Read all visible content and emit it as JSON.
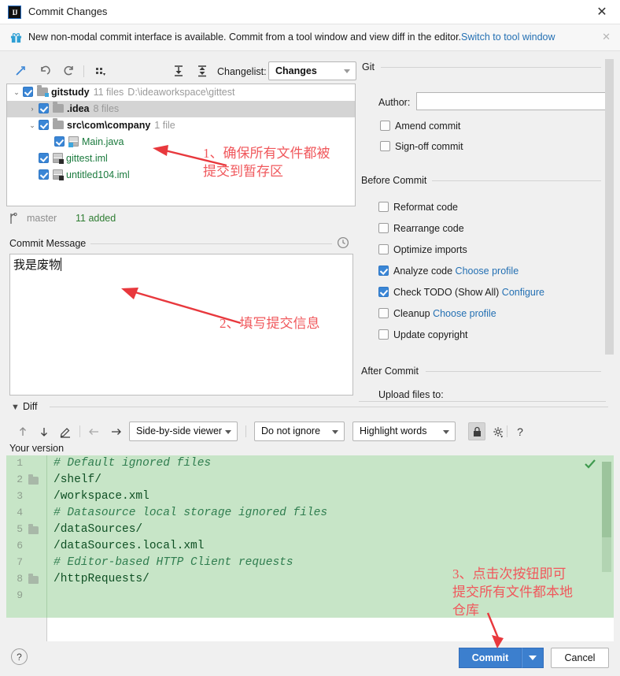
{
  "window": {
    "title": "Commit Changes",
    "icon": "intellij-idea-icon",
    "close_label": "✕"
  },
  "notice": {
    "icon": "gift-icon",
    "text": "New non-modal commit interface is available. Commit from a tool window and view diff in the editor.",
    "link": "Switch to tool window",
    "close_label": "✕"
  },
  "tree_toolbar": {
    "buttons": [
      {
        "name": "show-diff-icon",
        "glyph": "⤵"
      },
      {
        "name": "revert-icon",
        "glyph": "↶"
      },
      {
        "name": "refresh-icon",
        "glyph": "⟳"
      },
      {
        "name": "group-by-icon",
        "glyph": "∷"
      },
      {
        "name": "expand-all-icon",
        "glyph": "⤓"
      },
      {
        "name": "collapse-all-icon",
        "glyph": "⤒"
      }
    ],
    "changelist_label": "Changelist:",
    "changelist_value": "Changes"
  },
  "tree": {
    "rows": [
      {
        "indent": 0,
        "twisty": "⌄",
        "checked": true,
        "icon": "folder-module-icon",
        "name": "gitstudy",
        "name_color": "dark",
        "meta": "11 files",
        "meta2": "D:\\ideaworkspace\\gittest",
        "selected": false
      },
      {
        "indent": 1,
        "twisty": "›",
        "checked": true,
        "icon": "folder-icon",
        "name": ".idea",
        "name_color": "dark",
        "meta": "8 files",
        "meta2": "",
        "selected": true
      },
      {
        "indent": 1,
        "twisty": "⌄",
        "checked": true,
        "icon": "folder-icon",
        "name": "src\\com\\company",
        "name_color": "dark",
        "meta": "1 file",
        "meta2": "",
        "selected": false
      },
      {
        "indent": 2,
        "twisty": "",
        "checked": true,
        "icon": "java-file-icon",
        "name": "Main.java",
        "name_color": "green",
        "meta": "",
        "meta2": "",
        "selected": false
      },
      {
        "indent": 1,
        "twisty": "",
        "checked": true,
        "icon": "iml-file-icon",
        "name": "gittest.iml",
        "name_color": "green",
        "meta": "",
        "meta2": "",
        "selected": false
      },
      {
        "indent": 1,
        "twisty": "",
        "checked": true,
        "icon": "iml-file-icon",
        "name": "untitled104.iml",
        "name_color": "green",
        "meta": "",
        "meta2": "",
        "selected": false
      }
    ]
  },
  "status": {
    "branch_icon": "git-branch-icon",
    "branch": "master",
    "added": "11 added"
  },
  "commit_message": {
    "section_title": "Commit Message",
    "history_icon": "clock-history-icon",
    "value": "我是废物"
  },
  "git_panel": {
    "section_title": "Git",
    "author_label": "Author:",
    "author_value": "",
    "options": [
      {
        "label": "Amend commit",
        "checked": false
      },
      {
        "label": "Sign-off commit",
        "checked": false
      }
    ],
    "before_commit_title": "Before Commit",
    "before_commit": [
      {
        "label": "Reformat code",
        "checked": false,
        "link": ""
      },
      {
        "label": "Rearrange code",
        "checked": false,
        "link": ""
      },
      {
        "label": "Optimize imports",
        "checked": false,
        "link": ""
      },
      {
        "label": "Analyze code",
        "checked": true,
        "link": "Choose profile"
      },
      {
        "label": "Check TODO (Show All)",
        "checked": true,
        "link": "Configure"
      },
      {
        "label": "Cleanup",
        "checked": false,
        "link": "Choose profile"
      },
      {
        "label": "Update copyright",
        "checked": false,
        "link": ""
      }
    ],
    "after_commit_title": "After Commit",
    "after_commit_label": "Upload files to:"
  },
  "diff": {
    "section_title": "Diff",
    "collapse_glyph": "▼",
    "toolbar": {
      "prev_diff_icon": "↑",
      "next_diff_icon": "↓",
      "edit_icon": "✎",
      "back_icon": "←",
      "forward_icon": "→",
      "viewer_mode": "Side-by-side viewer",
      "whitespace_mode": "Do not ignore",
      "highlight_mode": "Highlight words",
      "lock_icon": "lock-icon",
      "settings_icon": "gear-icon",
      "help_icon": "?"
    },
    "pane_label": "Your version",
    "accept_icon": "check-icon",
    "lines": [
      {
        "no": "1",
        "text": "# Default ignored files",
        "comment": true,
        "fold": false
      },
      {
        "no": "2",
        "text": "/shelf/",
        "comment": false,
        "fold": true
      },
      {
        "no": "3",
        "text": "/workspace.xml",
        "comment": false,
        "fold": false
      },
      {
        "no": "4",
        "text": "# Datasource local storage ignored files",
        "comment": true,
        "fold": false
      },
      {
        "no": "5",
        "text": "/dataSources/",
        "comment": false,
        "fold": true
      },
      {
        "no": "6",
        "text": "/dataSources.local.xml",
        "comment": false,
        "fold": false
      },
      {
        "no": "7",
        "text": "# Editor-based HTTP Client requests",
        "comment": true,
        "fold": false
      },
      {
        "no": "8",
        "text": "/httpRequests/",
        "comment": false,
        "fold": true
      },
      {
        "no": "9",
        "text": "",
        "comment": false,
        "fold": false
      }
    ]
  },
  "footer": {
    "help_label": "?",
    "commit_label": "Commit",
    "commit_dropdown_icon": "chevron-down-icon",
    "cancel_label": "Cancel"
  },
  "annotations": [
    {
      "name": "annotation-1",
      "text": "1、确保所有文件都被\n提交到暂存区"
    },
    {
      "name": "annotation-2",
      "text": "2、填写提交信息"
    },
    {
      "name": "annotation-3",
      "text": "3、点击次按钮即可\n提交所有文件都本地\n仓库"
    }
  ],
  "colors": {
    "accent_blue": "#3c7fce",
    "link_blue": "#2470b3",
    "annotation_red": "#f0585c",
    "diff_added_green": "#c7e5c7",
    "added_text_green": "#2e7d32"
  }
}
